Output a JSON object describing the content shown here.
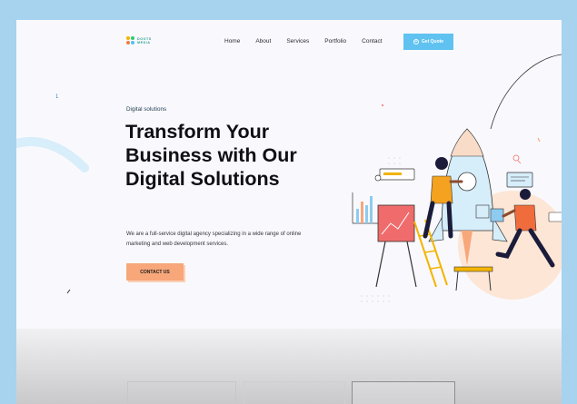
{
  "brand": {
    "logo_line1": "DOOTS",
    "logo_line2": "MEDIA",
    "colors": {
      "accent_blue": "#5fc2f0",
      "accent_orange": "#f7a77a",
      "teal": "#2a9d8f"
    }
  },
  "nav": {
    "items": [
      {
        "label": "Home"
      },
      {
        "label": "About"
      },
      {
        "label": "Services"
      },
      {
        "label": "Portfolio"
      },
      {
        "label": "Contact"
      }
    ],
    "cta_label": "Get Quote",
    "cta_icon": "plus-circle-icon"
  },
  "hero": {
    "eyebrow": "Digital solutions",
    "title": "Transform Your Business with Our Digital Solutions",
    "description": "We are a full-service digital agency specializing in a wide range of online marketing and web development services.",
    "button_label": "CONTACT US"
  },
  "decor": {
    "side_marker": "1",
    "illustration": "rocket-team-illustration"
  }
}
